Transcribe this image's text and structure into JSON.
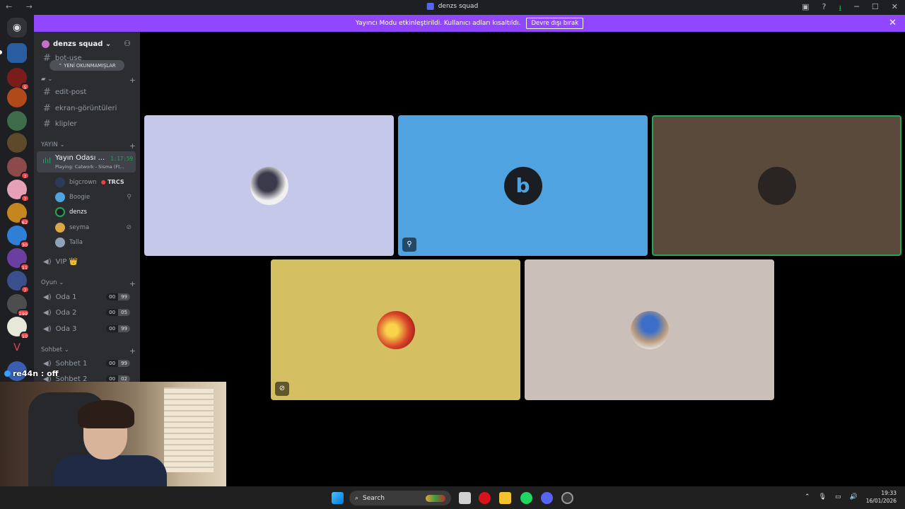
{
  "titlebar": {
    "title": "denzs squad",
    "nav": "← →"
  },
  "banner": {
    "message": "Yayıncı Modu etkinleştirildi. Kullanıcı adları kısaltıldı.",
    "button": "Devre dışı bırak",
    "close": "✕"
  },
  "server": {
    "name": "denzs squad ⌄"
  },
  "new_unread": "⌃ YENİ OKUNMAMIŞLAR",
  "channels_top": [
    "bot-use",
    "edit-post",
    "ekran-görüntüleri",
    "klipler"
  ],
  "categories": {
    "yayin": "YAYIN ⌄",
    "oyun": "Oyun ⌄",
    "sohbet": "Sohbet ⌄"
  },
  "stream": {
    "name": "Yayın Odası ...",
    "time": "1:17:59",
    "sub": "Playing: Catwork - Sisma (Ft..."
  },
  "users": [
    "bigcrown",
    "Boogie",
    "denzs",
    "seyma",
    "Talla"
  ],
  "user_tag": "TRCS",
  "vip": "VIP 👑",
  "oyun_channels": [
    {
      "name": "Oda 1",
      "a": "00",
      "b": "99"
    },
    {
      "name": "Oda 2",
      "a": "00",
      "b": "05"
    },
    {
      "name": "Oda 3",
      "a": "00",
      "b": "99"
    }
  ],
  "sohbet_channels": [
    {
      "name": "Sohbet 1",
      "a": "00",
      "b": "99"
    },
    {
      "name": "Sohbet 2",
      "a": "00",
      "b": "02"
    }
  ],
  "guild_badges": [
    "5",
    "7",
    "7",
    "62",
    "30",
    "11",
    "7",
    "299",
    "10"
  ],
  "overlay": "re44n : off",
  "taskbar": {
    "search": "Search",
    "time": "19:33",
    "date": "16/01/2026"
  },
  "colors": {
    "banner": "#9147ff",
    "speaking": "#23a55a",
    "tile1": "#c5c8e8",
    "tile2": "#4fa3e0",
    "tile3": "#5a4a3c",
    "tile4": "#d4c063",
    "tile5": "#cbbfba"
  }
}
